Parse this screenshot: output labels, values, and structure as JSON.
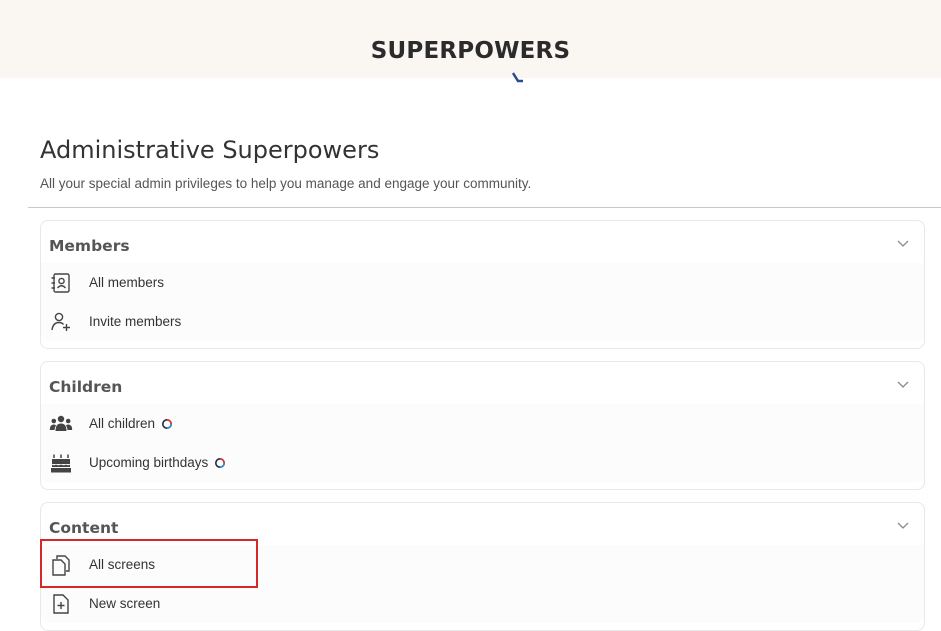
{
  "banner": {
    "title": "SUPERPOWERS"
  },
  "page": {
    "heading": "Administrative Superpowers",
    "subtitle": "All your special admin privileges to help you manage and engage your community."
  },
  "sections": [
    {
      "title": "Members",
      "items": [
        {
          "label": "All members",
          "icon": "member-list-icon"
        },
        {
          "label": "Invite members",
          "icon": "invite-user-icon"
        }
      ]
    },
    {
      "title": "Children",
      "items": [
        {
          "label": "All children",
          "icon": "group-icon",
          "badge": true
        },
        {
          "label": "Upcoming birthdays",
          "icon": "cake-icon",
          "badge": true
        }
      ]
    },
    {
      "title": "Content",
      "items": [
        {
          "label": "All screens",
          "icon": "copy-pages-icon",
          "highlighted": true
        },
        {
          "label": "New screen",
          "icon": "new-page-icon"
        }
      ]
    }
  ],
  "colors": {
    "banner_bg": "#faf6f2",
    "highlight": "#d62828",
    "text": "#333333"
  }
}
